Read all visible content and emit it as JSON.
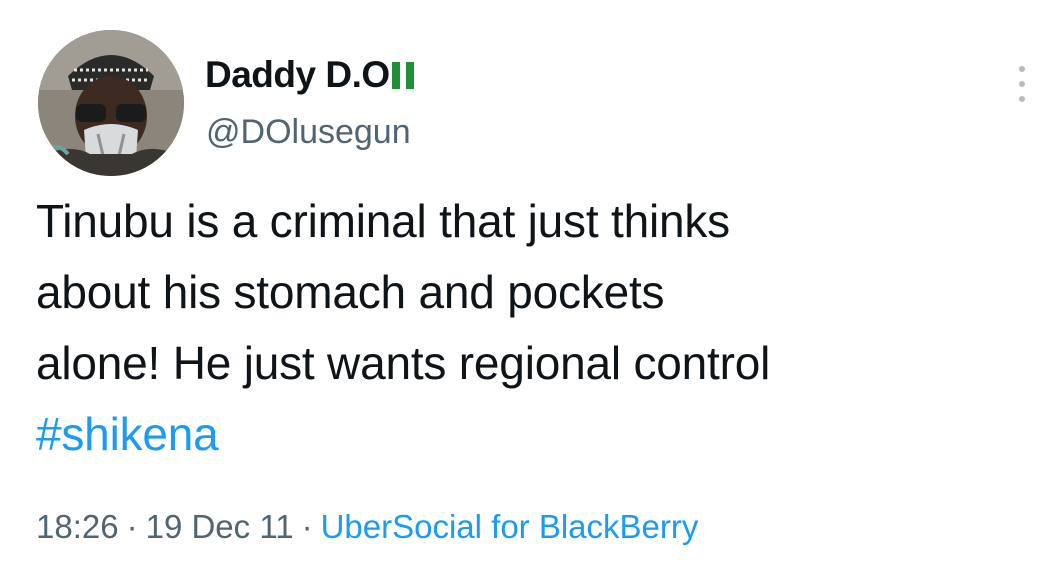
{
  "tweet": {
    "display_name": "Daddy D.O",
    "flag_icon": "nigeria-flag-icon",
    "username": "@DOlusegun",
    "more_icon": "more-vertical-icon",
    "text_lines": [
      "Tinubu is a criminal that just thinks",
      "about his stomach and pockets",
      "alone! He just wants regional control"
    ],
    "hashtag": "#shikena",
    "time": "18:26",
    "separator": "·",
    "date": "19 Dec 11",
    "source": "UberSocial for BlackBerry"
  },
  "colors": {
    "link": "#1d9bf0",
    "secondary_text": "#536471",
    "primary_text": "#0f1419",
    "flag_green": "#1f8f3a"
  }
}
